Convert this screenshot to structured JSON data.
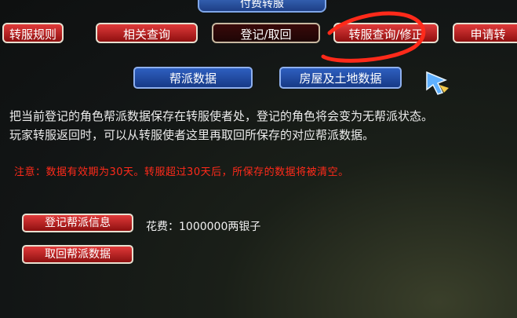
{
  "window": {
    "title": "付费转服"
  },
  "tabs": [
    {
      "label": "转服规则"
    },
    {
      "label": "相关查询"
    },
    {
      "label": "登记/取回",
      "active": true
    },
    {
      "label": "转服查询/修正"
    },
    {
      "label": "申请转"
    }
  ],
  "subtabs": [
    {
      "label": "帮派数据"
    },
    {
      "label": "房屋及土地数据"
    }
  ],
  "description": {
    "line1": "把当前登记的角色帮派数据保存在转服使者处，登记的角色将会变为无帮派状态。",
    "line2": "玩家转服返回时，可以从转服使者这里再取回所保存的对应帮派数据。"
  },
  "notice": "注意：数据有效期为30天。转服超过30天后，所保存的数据将被清空。",
  "actions": {
    "register_label": "登记帮派信息",
    "retrieve_label": "取回帮派数据",
    "cost_text": "花费：1000000两银子"
  },
  "colors": {
    "tab_red": "#c01a1a",
    "subtab_blue": "#2e5fc0",
    "notice_red": "#ff2a1a",
    "annotation_red": "#ff2a1a"
  },
  "icons": {
    "cursor": "pointer-cursor-icon"
  }
}
